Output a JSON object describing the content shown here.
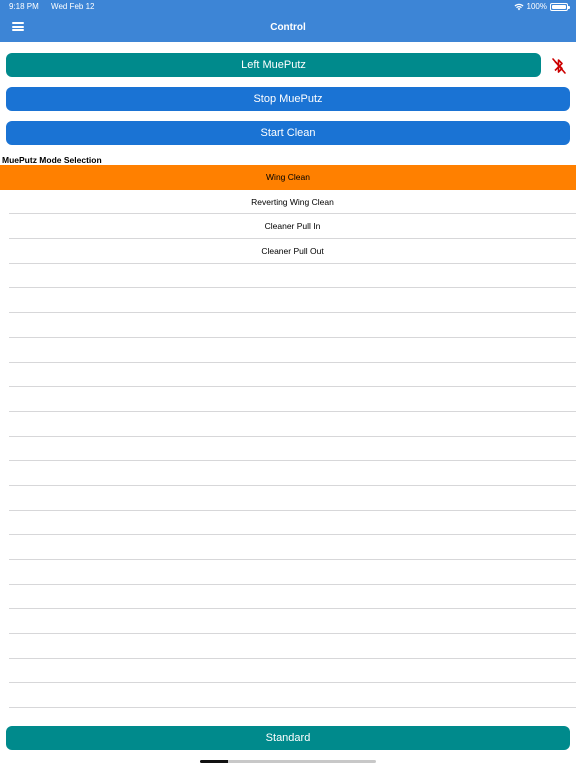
{
  "status_bar": {
    "time": "9:18 PM",
    "date": "Wed Feb 12",
    "battery": "100%",
    "wifi_icon": "wifi-icon",
    "battery_icon": "battery-icon"
  },
  "nav": {
    "title": "Control",
    "menu_icon": "hamburger-menu-icon"
  },
  "controls": {
    "side_button": "Left MuePutz",
    "stop_button": "Stop MuePutz",
    "start_button": "Start Clean",
    "bluetooth_icon": "bluetooth-disabled-icon",
    "bluetooth_color": "#cc0000"
  },
  "mode_selection": {
    "label": "MuePutz Mode Selection",
    "items": [
      {
        "label": "Wing Clean",
        "selected": true
      },
      {
        "label": "Reverting Wing Clean",
        "selected": false
      },
      {
        "label": "Cleaner Pull In",
        "selected": false
      },
      {
        "label": "Cleaner Pull Out",
        "selected": false
      }
    ],
    "selected_color": "#ff8000"
  },
  "footer": {
    "standard_button": "Standard"
  },
  "colors": {
    "nav_bar": "#3d85d6",
    "teal": "#008a8c",
    "blue": "#1a73d4"
  }
}
